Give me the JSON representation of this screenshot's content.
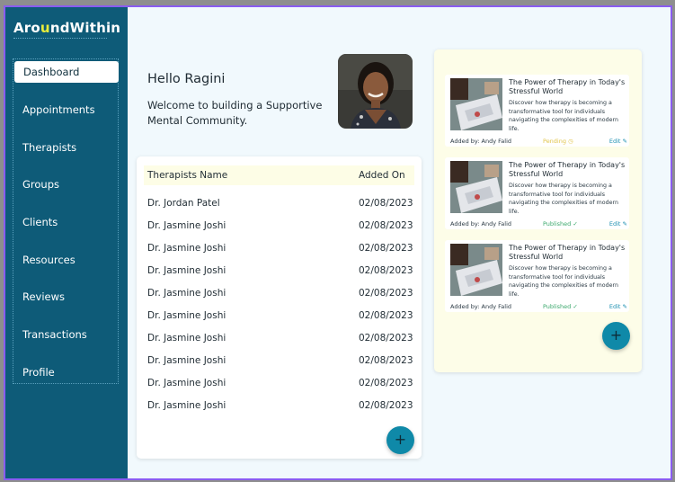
{
  "brand": {
    "prefix": "Aro",
    "accent": "u",
    "suffix": "ndWithin"
  },
  "sidebar": {
    "items": [
      {
        "label": "Dashboard",
        "active": true
      },
      {
        "label": "Appointments"
      },
      {
        "label": "Therapists"
      },
      {
        "label": "Groups"
      },
      {
        "label": "Clients"
      },
      {
        "label": "Resources"
      },
      {
        "label": "Reviews"
      },
      {
        "label": "Transactions"
      },
      {
        "label": "Profile"
      }
    ]
  },
  "greeting": {
    "title": "Hello Ragini",
    "subtitle": "Welcome to building a Supportive Mental Community."
  },
  "therapists_table": {
    "headers": [
      "Therapists Name",
      "Added On"
    ],
    "rows": [
      [
        "Dr. Jordan Patel",
        "02/08/2023"
      ],
      [
        "Dr. Jasmine Joshi",
        "02/08/2023"
      ],
      [
        "Dr. Jasmine Joshi",
        "02/08/2023"
      ],
      [
        "Dr. Jasmine Joshi",
        "02/08/2023"
      ],
      [
        "Dr. Jasmine Joshi",
        "02/08/2023"
      ],
      [
        "Dr. Jasmine Joshi",
        "02/08/2023"
      ],
      [
        "Dr. Jasmine Joshi",
        "02/08/2023"
      ],
      [
        "Dr. Jasmine Joshi",
        "02/08/2023"
      ],
      [
        "Dr. Jasmine Joshi",
        "02/08/2023"
      ],
      [
        "Dr. Jasmine Joshi",
        "02/08/2023"
      ]
    ],
    "add_label": "+"
  },
  "resources": {
    "items": [
      {
        "title": "The Power of Therapy in Today's Stressful World",
        "description": "Discover how therapy is becoming a transformative tool for individuals navigating the complexities of modern life.",
        "added_by": "Added by: Andy Falid",
        "status": "Pending",
        "status_icon": "clock-icon",
        "edit": "Edit"
      },
      {
        "title": "The Power of Therapy in Today's Stressful World",
        "description": "Discover how therapy is becoming a transformative tool for individuals navigating the complexities of modern life.",
        "added_by": "Added by: Andy Falid",
        "status": "Published",
        "status_icon": "check-circle-icon",
        "edit": "Edit"
      },
      {
        "title": "The Power of Therapy in Today's Stressful World",
        "description": "Discover how therapy is becoming a transformative tool for individuals navigating the complexities of modern life.",
        "added_by": "Added by: Andy Falid",
        "status": "Published",
        "status_icon": "check-circle-icon",
        "edit": "Edit"
      }
    ],
    "add_label": "+"
  },
  "colors": {
    "sidebar": "#0e5b78",
    "accent": "#e8ec3a",
    "fab": "#0f89a8",
    "pending": "#e0c44a",
    "published": "#3aa86b",
    "link": "#1b8fb0"
  }
}
